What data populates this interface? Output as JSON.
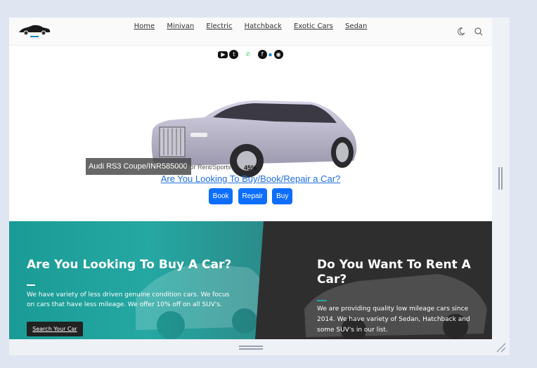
{
  "nav": {
    "items": [
      "Home",
      "Minivan",
      "Electric",
      "Hatchback",
      "Exotic Cars",
      "Sedan"
    ],
    "logo_icon": "car-logo-icon",
    "icons": [
      "moon-icon",
      "search-icon"
    ]
  },
  "social": [
    "youtube-icon",
    "twitter-icon",
    "whatsapp-icon",
    "facebook-icon",
    "linkedin-icon",
    "github-icon"
  ],
  "hero": {
    "caption": "Audi RS3 Coupe/INR585000",
    "caption_sub": "For Rent/Sports",
    "caption_pct": "45%",
    "link": "Are You Looking To Buy/Book/Repair a Car?",
    "buttons": [
      "Book",
      "Repair",
      "Buy"
    ]
  },
  "promo": {
    "left_title": "Are You Looking To Buy A Car?",
    "left_text": "We have variety of less driven genuine condition cars. We focus on cars that have less mileage. We offer 10% off on all SUV's.",
    "left_button": "Search Your Car",
    "right_title": "Do You Want To Rent A Car?",
    "right_text": "We are providing quality low mileage cars since 2014. We have variety of Sedan, Hatchback and some SUV's in our list."
  },
  "colors": {
    "primary": "#0d6efd",
    "teal": "#25a7a2",
    "dark": "#2e2e2f"
  }
}
